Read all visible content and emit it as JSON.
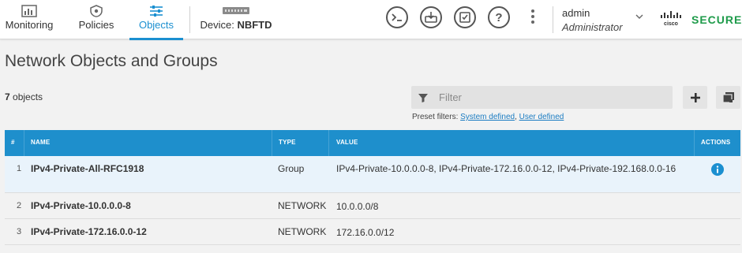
{
  "nav": {
    "monitoring": "Monitoring",
    "policies": "Policies",
    "objects": "Objects",
    "device_prefix": "Device:",
    "device_name": "NBFTD"
  },
  "user": {
    "name": "admin",
    "role": "Administrator"
  },
  "brand": {
    "cisco": "cisco",
    "product": "SECURE",
    "color": "#1e9b4a"
  },
  "colors": {
    "accent": "#1b8fd0",
    "table_header": "#1e8fcc",
    "link": "#1b7cc2"
  },
  "page": {
    "title": "Network Objects and Groups",
    "count_num": "7",
    "count_label": " objects"
  },
  "filter": {
    "placeholder": "Filter",
    "preset_label": "Preset filters:",
    "preset_system": "System defined",
    "preset_sep": ", ",
    "preset_user": "User defined"
  },
  "table": {
    "headers": {
      "num": "#",
      "name": "NAME",
      "type": "TYPE",
      "value": "VALUE",
      "actions": "ACTIONS"
    },
    "rows": [
      {
        "num": "1",
        "name": "IPv4-Private-All-RFC1918",
        "type": "Group",
        "value": "IPv4-Private-10.0.0.0-8, IPv4-Private-172.16.0.0-12, IPv4-Private-192.168.0.0-16"
      },
      {
        "num": "2",
        "name": "IPv4-Private-10.0.0.0-8",
        "type": "NETWORK",
        "value": "10.0.0.0/8"
      },
      {
        "num": "3",
        "name": "IPv4-Private-172.16.0.0-12",
        "type": "NETWORK",
        "value": "172.16.0.0/12"
      }
    ]
  },
  "icons": {
    "monitoring": "monitoring-chart-icon",
    "policies": "shield-icon",
    "objects": "sliders-icon",
    "device": "device-appliance-icon",
    "cli": "cli-console-icon",
    "deploy": "deploy-icon",
    "tasks": "task-list-icon",
    "help": "help-icon",
    "more": "more-options-icon",
    "filter": "filter-icon",
    "add": "plus-icon",
    "other_action": "copy-icon",
    "info": "info-icon"
  }
}
